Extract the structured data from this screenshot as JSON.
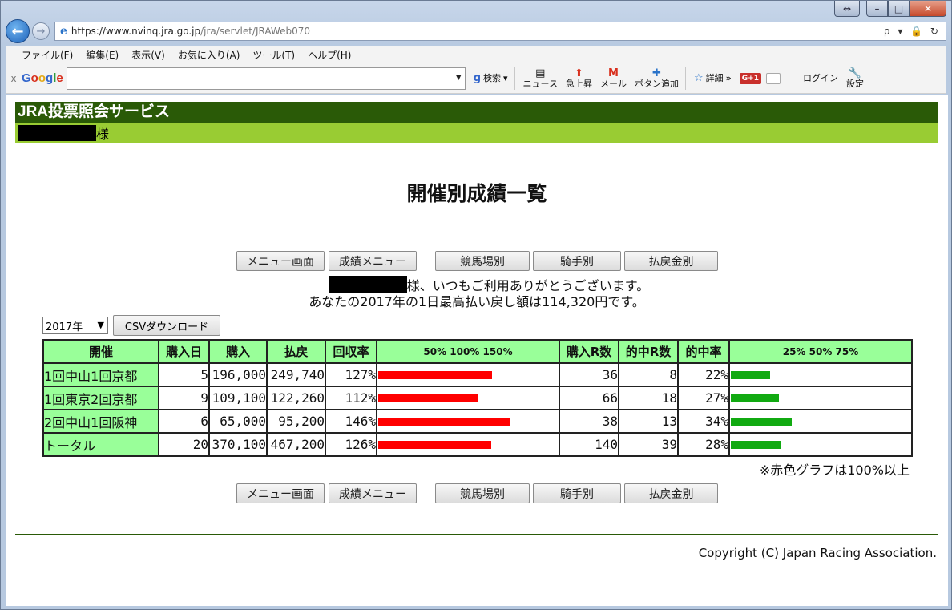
{
  "browser": {
    "url_main": "https://www.nvinq.jra.go.jp",
    "url_rest": "/jra/servlet/JRAWeb070",
    "address_tools": "ρ ▾ 🔒 ↻",
    "menu": [
      "ファイル(F)",
      "編集(E)",
      "表示(V)",
      "お気に入り(A)",
      "ツール(T)",
      "ヘルプ(H)"
    ],
    "toolbar": {
      "close": "x",
      "search_label": "検索",
      "news": "ニュース",
      "rising": "急上昇",
      "mail": "メール",
      "add_button": "ボタン追加",
      "details": "詳細",
      "more": "»",
      "gplus": "G+1",
      "login": "ログイン",
      "settings": "設定"
    }
  },
  "site": {
    "service_name": "JRA投票照会サービス",
    "user_suffix": "様"
  },
  "page": {
    "title": "開催別成績一覧",
    "nav_buttons": [
      "メニュー画面",
      "成績メニュー",
      "競馬場別",
      "騎手別",
      "払戻金別"
    ],
    "greeting_suffix": "様、いつもご利用ありがとうございます。",
    "greeting_line2": "あなたの2017年の1日最高払い戻し額は114,320円です。",
    "year_selected": "2017年",
    "csv_button": "CSVダウンロード",
    "note": "※赤色グラフは100%以上",
    "copyright": "Copyright (C) Japan Racing Association."
  },
  "table": {
    "headers": {
      "venue": "開催",
      "days": "購入日",
      "purchase": "購入",
      "payout": "払戻",
      "recovery": "回収率",
      "recovery_scale": "50%  100%  150%",
      "races": "購入R数",
      "hits": "的中R数",
      "hit_rate": "的中率",
      "hit_scale": "25%   50%   75%"
    },
    "rows": [
      {
        "venue": "1回中山1回京都",
        "days": "5",
        "purchase": "196,000",
        "payout": "249,740",
        "recovery": "127%",
        "recovery_value": 127,
        "races": "36",
        "hits": "8",
        "hit_rate": "22%",
        "hit_value": 22
      },
      {
        "venue": "1回東京2回京都",
        "days": "9",
        "purchase": "109,100",
        "payout": "122,260",
        "recovery": "112%",
        "recovery_value": 112,
        "races": "66",
        "hits": "18",
        "hit_rate": "27%",
        "hit_value": 27
      },
      {
        "venue": "2回中山1回阪神",
        "days": "6",
        "purchase": " 65,000",
        "payout": " 95,200",
        "recovery": "146%",
        "recovery_value": 146,
        "races": "38",
        "hits": "13",
        "hit_rate": "34%",
        "hit_value": 34
      },
      {
        "venue": "トータル",
        "days": "20",
        "purchase": "370,100",
        "payout": "467,200",
        "recovery": "126%",
        "recovery_value": 126,
        "races": "140",
        "hits": "39",
        "hit_rate": "28%",
        "hit_value": 28
      }
    ],
    "colors": {
      "header_bg": "#99ff99",
      "red_bar": "#ff0000",
      "green_bar": "#11aa11"
    }
  }
}
